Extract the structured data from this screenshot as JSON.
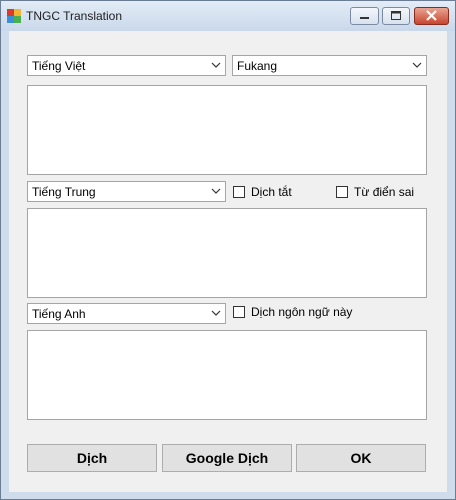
{
  "window": {
    "title": "TNGC Translation"
  },
  "source_language": {
    "value": "Tiếng Việt"
  },
  "source_font": {
    "value": "Fukang"
  },
  "chinese": {
    "language": "Tiếng Trung",
    "dich_tat_label": "Dịch tắt",
    "dich_tat_checked": false,
    "tu_dien_sai_label": "Từ điển sai",
    "tu_dien_sai_checked": false
  },
  "english": {
    "language": "Tiếng Anh",
    "translate_this_label": "Dịch ngôn ngữ này",
    "translate_this_checked": false
  },
  "buttons": {
    "translate": "Dịch",
    "google": "Google Dịch",
    "ok": "OK"
  }
}
